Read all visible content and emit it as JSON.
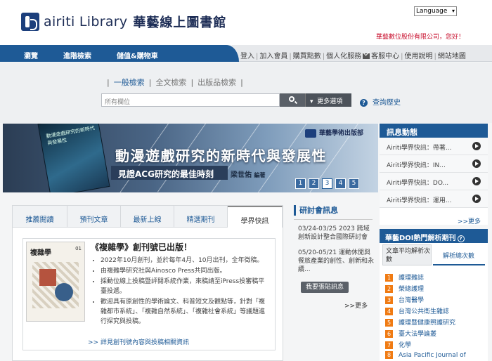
{
  "header": {
    "logo_text": "airiti Library",
    "logo_cn": "華藝線上圖書館",
    "language_label": "Language",
    "greeting": "華藝數位股份有限公司，您好！"
  },
  "nav": {
    "main": [
      "瀏覽",
      "進階檢索",
      "儲值&購物車"
    ],
    "links": [
      "登入",
      "加入會員",
      "購買點數",
      "個人化服務",
      "客服中心",
      "使用說明",
      "網站地圖"
    ]
  },
  "search": {
    "tabs": [
      "一般檢索",
      "全文檢索",
      "出版品檢索"
    ],
    "placeholder": "所有欄位",
    "more_options": "更多選項",
    "history": "查詢歷史"
  },
  "banner": {
    "publisher": "華藝學術出版部",
    "title": "動漫遊戲研究的新時代與發展性",
    "subtitle": "見證ACG研究的最佳時刻",
    "author": "梁世佑",
    "author_role": "編著",
    "book_title": "動漫遊戲研究的新時代與發展性",
    "pages": [
      "1",
      "2",
      "3",
      "4",
      "5"
    ],
    "current_page": 3
  },
  "news": {
    "heading": "訊息動態",
    "items": [
      "Airiti學界快訊：帶著...",
      "Airiti學界快訊：IN...",
      "Airiti學界快訊：DO...",
      "Airiti學界快訊：運用..."
    ],
    "more": ">>更多"
  },
  "tabs": {
    "labels": [
      "推薦閱讀",
      "預刊文章",
      "最新上線",
      "精選期刊",
      "學界快訊"
    ],
    "active_index": 4
  },
  "article": {
    "cover_title": "複雜學",
    "cover_issue": "01",
    "title": "《複雜學》創刊號已出版！",
    "bullets": [
      "2022年10月創刊，並於每年4月、10月出刊，全年徵稿。",
      "由複雜學研究社與Ainosco Press共同出版。",
      "採動位線上投稿暨評閱系統作業，來稿請至iPress投審稿平臺投遞。",
      "歡迎具有原創性的學術論文、科普短文及觀點等，針對「複雜都市系統」、「複雜自然系統」、「複雜社會系統」等議題進行探究與投稿。"
    ],
    "detail_link": ">> 詳見創刊號內容與投稿相關資訊"
  },
  "seminar": {
    "heading": "研討會訊息",
    "items": [
      "03/24-03/25 2023 跨域創新設計整合國際研討會",
      "05/20-05/21 運動休閒與餐旅產業的創性、創新和永續..."
    ],
    "button": "我要張貼訊息",
    "more": ">>更多"
  },
  "doi": {
    "heading": "華藝DOI熱門解析期刊",
    "tab1": "文章平均解析次數",
    "tab2": "解析總次數",
    "ranks": [
      "護理雜誌",
      "榮總護理",
      "台灣醫學",
      "台灣公共衛生雜誌",
      "護理暨健康照護研究",
      "臺大法學論叢",
      "化學",
      "Asia Pacific Journal of"
    ]
  },
  "colors": {
    "primary_blue": "#1e5a96",
    "rank_orange": "#f07b13",
    "greeting_red": "#c8102e"
  }
}
